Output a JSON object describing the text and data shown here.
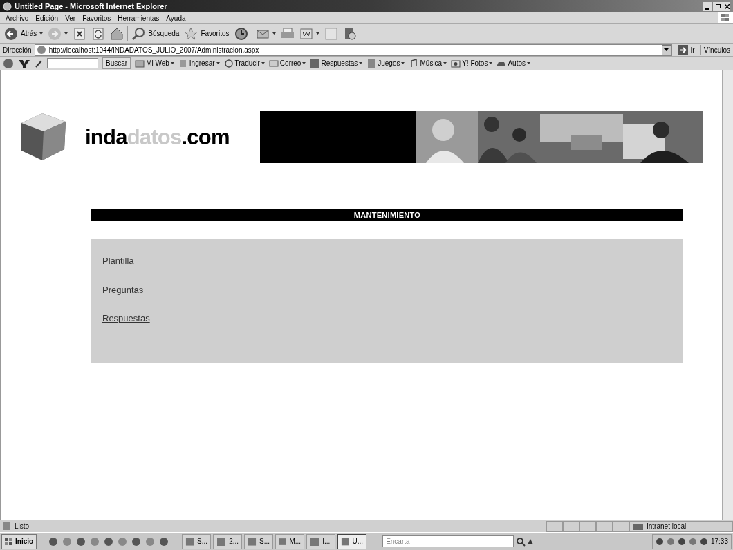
{
  "window": {
    "title": "Untitled Page - Microsoft Internet Explorer"
  },
  "menu": [
    "Archivo",
    "Edición",
    "Ver",
    "Favoritos",
    "Herramientas",
    "Ayuda"
  ],
  "toolbar": [
    {
      "label": "Atrás",
      "dropdown": true
    },
    {
      "dropdown": true
    },
    {
      "dropdown": false
    },
    {
      "dropdown": false
    },
    {
      "dropdown": false
    },
    {
      "label": "Búsqueda",
      "dropdown": false
    },
    {
      "label": "Favoritos",
      "dropdown": false
    },
    {
      "dropdown": false
    },
    {
      "dropdown": true
    },
    {
      "dropdown": false
    },
    {
      "dropdown": true
    },
    {
      "dropdown": false
    },
    {
      "dropdown": false
    }
  ],
  "address": {
    "label": "Dirección",
    "value": "http://localhost:1044/INDADATOS_JULIO_2007/Administracion.aspx",
    "go": "Ir",
    "links": "Vínculos"
  },
  "yahoo_bar": {
    "search_button": "Buscar",
    "items": [
      {
        "label": "Mi Web"
      },
      {
        "label": "Ingresar"
      },
      {
        "label": "Traducir"
      },
      {
        "label": "Correo"
      },
      {
        "label": "Respuestas"
      },
      {
        "label": "Juegos"
      },
      {
        "label": "Música"
      },
      {
        "label": "Y! Fotos"
      },
      {
        "label": "Autos"
      }
    ]
  },
  "page": {
    "logo": [
      "inda",
      "datos",
      ".com"
    ],
    "section_title": "MANTENIMIENTO",
    "links": [
      "Plantilla",
      "Preguntas",
      "Respuestas"
    ]
  },
  "status_bar": {
    "text": "Listo",
    "zone": "Intranet local"
  },
  "taskbar": {
    "start": "Inicio",
    "tasks": [
      {
        "label": "S...",
        "selected": false
      },
      {
        "label": "2...",
        "selected": false
      },
      {
        "label": "S...",
        "selected": false
      },
      {
        "label": "M...",
        "selected": false
      },
      {
        "label": "I...",
        "selected": false
      },
      {
        "label": "U...",
        "selected": true
      }
    ],
    "search_placeholder": "Encarta",
    "clock": "17:33"
  }
}
